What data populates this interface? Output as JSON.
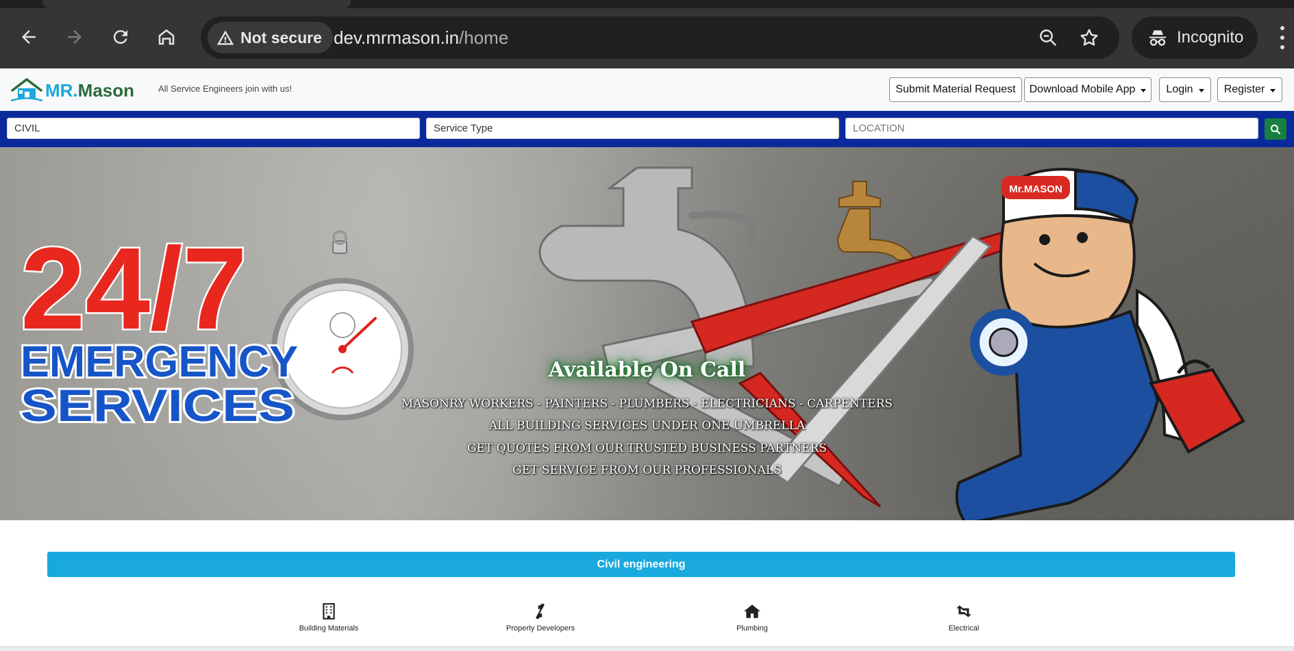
{
  "browser": {
    "security_label": "Not secure",
    "url_host": "dev.mrmason.in",
    "url_path": "/home",
    "profile_label": "Incognito"
  },
  "header": {
    "logo_mr": "MR.",
    "logo_mason": "Mason",
    "tagline": "All Service Engineers join with us!",
    "buttons": {
      "submit_request": "Submit Material Request",
      "download_app": "Download Mobile App",
      "login": "Login",
      "register": "Register"
    }
  },
  "search": {
    "category_value": "CIVIL",
    "service_type_value": "Service Type",
    "location_placeholder": "LOCATION"
  },
  "hero": {
    "badge_top": "24/7",
    "badge_line1": "EMERGENCY",
    "badge_line2": "SERVICES",
    "cap_logo": "Mr.MASON",
    "title": "Available On Call",
    "lines": [
      "MASONRY WORKERS - PAINTERS - PLUMBERS - ELECTRICIANS - CARPENTERS",
      "ALL BUILDING SERVICES UNDER ONE UMBRELLA",
      "GET QUOTES FROM OUR TRUSTED BUSINESS PARTNERS",
      "GET SERVICE FROM OUR PROFESSIONALS"
    ]
  },
  "categories": {
    "heading": "Civil engineering",
    "items": [
      {
        "label": "Building Materials",
        "icon": "building-icon"
      },
      {
        "label": "Property Developers",
        "icon": "deviantart-icon"
      },
      {
        "label": "Plumbing",
        "icon": "home-icon"
      },
      {
        "label": "Electrical",
        "icon": "retweet-icon"
      }
    ]
  },
  "colors": {
    "search_bar": "#0a2a9c",
    "category_bar": "#1aa9de",
    "search_button": "#17803e"
  }
}
